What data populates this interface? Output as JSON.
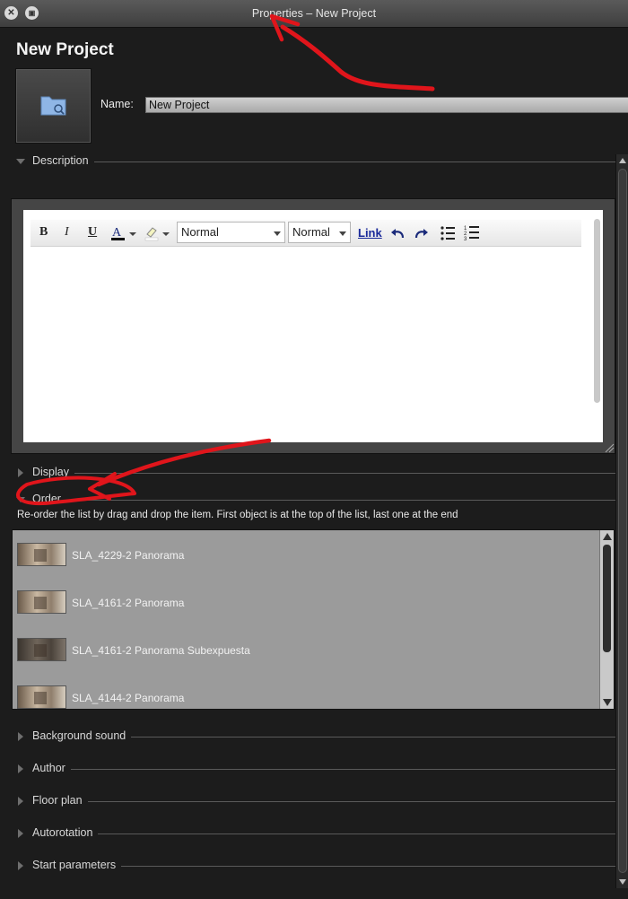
{
  "window": {
    "title": "Properties – New Project"
  },
  "project": {
    "title": "New Project",
    "name_label": "Name:",
    "name_value": "New Project"
  },
  "sections": {
    "description": "Description",
    "display": "Display",
    "order": "Order",
    "background_sound": "Background sound",
    "author": "Author",
    "floor_plan": "Floor plan",
    "autorotation": "Autorotation",
    "start_parameters": "Start parameters"
  },
  "editor": {
    "bold": "B",
    "italic": "I",
    "underline": "U",
    "format_select": "Normal",
    "size_select": "Normal",
    "link": "Link"
  },
  "order": {
    "description": "Re-order the list by drag and drop the item. First object is at the top of the list, last one at the end",
    "items": [
      "SLA_4229-2 Panorama",
      "SLA_4161-2 Panorama",
      "SLA_4161-2 Panorama Subexpuesta",
      "SLA_4144-2 Panorama"
    ]
  },
  "colors": {
    "background": "#1c1c1c",
    "annotation": "#e0151b",
    "link": "#1a2a9a"
  }
}
